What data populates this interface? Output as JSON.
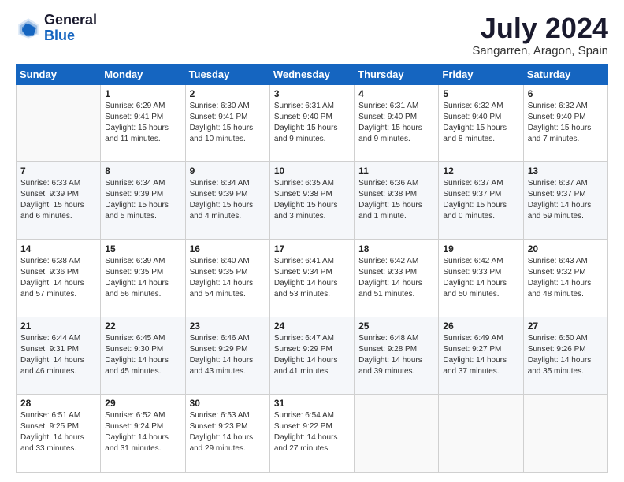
{
  "logo": {
    "general": "General",
    "blue": "Blue"
  },
  "title": "July 2024",
  "location": "Sangarren, Aragon, Spain",
  "days_of_week": [
    "Sunday",
    "Monday",
    "Tuesday",
    "Wednesday",
    "Thursday",
    "Friday",
    "Saturday"
  ],
  "weeks": [
    [
      {
        "day": "",
        "sunrise": "",
        "sunset": "",
        "daylight": ""
      },
      {
        "day": "1",
        "sunrise": "Sunrise: 6:29 AM",
        "sunset": "Sunset: 9:41 PM",
        "daylight": "Daylight: 15 hours and 11 minutes."
      },
      {
        "day": "2",
        "sunrise": "Sunrise: 6:30 AM",
        "sunset": "Sunset: 9:41 PM",
        "daylight": "Daylight: 15 hours and 10 minutes."
      },
      {
        "day": "3",
        "sunrise": "Sunrise: 6:31 AM",
        "sunset": "Sunset: 9:40 PM",
        "daylight": "Daylight: 15 hours and 9 minutes."
      },
      {
        "day": "4",
        "sunrise": "Sunrise: 6:31 AM",
        "sunset": "Sunset: 9:40 PM",
        "daylight": "Daylight: 15 hours and 9 minutes."
      },
      {
        "day": "5",
        "sunrise": "Sunrise: 6:32 AM",
        "sunset": "Sunset: 9:40 PM",
        "daylight": "Daylight: 15 hours and 8 minutes."
      },
      {
        "day": "6",
        "sunrise": "Sunrise: 6:32 AM",
        "sunset": "Sunset: 9:40 PM",
        "daylight": "Daylight: 15 hours and 7 minutes."
      }
    ],
    [
      {
        "day": "7",
        "sunrise": "Sunrise: 6:33 AM",
        "sunset": "Sunset: 9:39 PM",
        "daylight": "Daylight: 15 hours and 6 minutes."
      },
      {
        "day": "8",
        "sunrise": "Sunrise: 6:34 AM",
        "sunset": "Sunset: 9:39 PM",
        "daylight": "Daylight: 15 hours and 5 minutes."
      },
      {
        "day": "9",
        "sunrise": "Sunrise: 6:34 AM",
        "sunset": "Sunset: 9:39 PM",
        "daylight": "Daylight: 15 hours and 4 minutes."
      },
      {
        "day": "10",
        "sunrise": "Sunrise: 6:35 AM",
        "sunset": "Sunset: 9:38 PM",
        "daylight": "Daylight: 15 hours and 3 minutes."
      },
      {
        "day": "11",
        "sunrise": "Sunrise: 6:36 AM",
        "sunset": "Sunset: 9:38 PM",
        "daylight": "Daylight: 15 hours and 1 minute."
      },
      {
        "day": "12",
        "sunrise": "Sunrise: 6:37 AM",
        "sunset": "Sunset: 9:37 PM",
        "daylight": "Daylight: 15 hours and 0 minutes."
      },
      {
        "day": "13",
        "sunrise": "Sunrise: 6:37 AM",
        "sunset": "Sunset: 9:37 PM",
        "daylight": "Daylight: 14 hours and 59 minutes."
      }
    ],
    [
      {
        "day": "14",
        "sunrise": "Sunrise: 6:38 AM",
        "sunset": "Sunset: 9:36 PM",
        "daylight": "Daylight: 14 hours and 57 minutes."
      },
      {
        "day": "15",
        "sunrise": "Sunrise: 6:39 AM",
        "sunset": "Sunset: 9:35 PM",
        "daylight": "Daylight: 14 hours and 56 minutes."
      },
      {
        "day": "16",
        "sunrise": "Sunrise: 6:40 AM",
        "sunset": "Sunset: 9:35 PM",
        "daylight": "Daylight: 14 hours and 54 minutes."
      },
      {
        "day": "17",
        "sunrise": "Sunrise: 6:41 AM",
        "sunset": "Sunset: 9:34 PM",
        "daylight": "Daylight: 14 hours and 53 minutes."
      },
      {
        "day": "18",
        "sunrise": "Sunrise: 6:42 AM",
        "sunset": "Sunset: 9:33 PM",
        "daylight": "Daylight: 14 hours and 51 minutes."
      },
      {
        "day": "19",
        "sunrise": "Sunrise: 6:42 AM",
        "sunset": "Sunset: 9:33 PM",
        "daylight": "Daylight: 14 hours and 50 minutes."
      },
      {
        "day": "20",
        "sunrise": "Sunrise: 6:43 AM",
        "sunset": "Sunset: 9:32 PM",
        "daylight": "Daylight: 14 hours and 48 minutes."
      }
    ],
    [
      {
        "day": "21",
        "sunrise": "Sunrise: 6:44 AM",
        "sunset": "Sunset: 9:31 PM",
        "daylight": "Daylight: 14 hours and 46 minutes."
      },
      {
        "day": "22",
        "sunrise": "Sunrise: 6:45 AM",
        "sunset": "Sunset: 9:30 PM",
        "daylight": "Daylight: 14 hours and 45 minutes."
      },
      {
        "day": "23",
        "sunrise": "Sunrise: 6:46 AM",
        "sunset": "Sunset: 9:29 PM",
        "daylight": "Daylight: 14 hours and 43 minutes."
      },
      {
        "day": "24",
        "sunrise": "Sunrise: 6:47 AM",
        "sunset": "Sunset: 9:29 PM",
        "daylight": "Daylight: 14 hours and 41 minutes."
      },
      {
        "day": "25",
        "sunrise": "Sunrise: 6:48 AM",
        "sunset": "Sunset: 9:28 PM",
        "daylight": "Daylight: 14 hours and 39 minutes."
      },
      {
        "day": "26",
        "sunrise": "Sunrise: 6:49 AM",
        "sunset": "Sunset: 9:27 PM",
        "daylight": "Daylight: 14 hours and 37 minutes."
      },
      {
        "day": "27",
        "sunrise": "Sunrise: 6:50 AM",
        "sunset": "Sunset: 9:26 PM",
        "daylight": "Daylight: 14 hours and 35 minutes."
      }
    ],
    [
      {
        "day": "28",
        "sunrise": "Sunrise: 6:51 AM",
        "sunset": "Sunset: 9:25 PM",
        "daylight": "Daylight: 14 hours and 33 minutes."
      },
      {
        "day": "29",
        "sunrise": "Sunrise: 6:52 AM",
        "sunset": "Sunset: 9:24 PM",
        "daylight": "Daylight: 14 hours and 31 minutes."
      },
      {
        "day": "30",
        "sunrise": "Sunrise: 6:53 AM",
        "sunset": "Sunset: 9:23 PM",
        "daylight": "Daylight: 14 hours and 29 minutes."
      },
      {
        "day": "31",
        "sunrise": "Sunrise: 6:54 AM",
        "sunset": "Sunset: 9:22 PM",
        "daylight": "Daylight: 14 hours and 27 minutes."
      },
      {
        "day": "",
        "sunrise": "",
        "sunset": "",
        "daylight": ""
      },
      {
        "day": "",
        "sunrise": "",
        "sunset": "",
        "daylight": ""
      },
      {
        "day": "",
        "sunrise": "",
        "sunset": "",
        "daylight": ""
      }
    ]
  ]
}
